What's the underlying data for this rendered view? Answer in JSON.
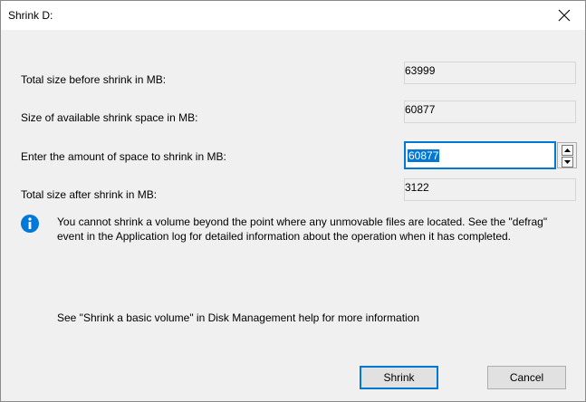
{
  "window": {
    "title": "Shrink D:"
  },
  "fields": {
    "total_before": {
      "label": "Total size before shrink in MB:",
      "value": "63999"
    },
    "available": {
      "label": "Size of available shrink space in MB:",
      "value": "60877"
    },
    "amount": {
      "label": "Enter the amount of space to shrink in MB:",
      "value": "60877"
    },
    "total_after": {
      "label": "Total size after shrink in MB:",
      "value": "3122"
    }
  },
  "info": {
    "icon": "info-icon",
    "text": "You cannot shrink a volume beyond the point where any unmovable files are located. See the \"defrag\" event in the Application log for detailed information about the operation when it has completed."
  },
  "help": {
    "text": "See \"Shrink a basic volume\" in Disk Management help for more information"
  },
  "buttons": {
    "shrink": "Shrink",
    "cancel": "Cancel"
  },
  "colors": {
    "accent": "#0078d7",
    "info_icon": "#0078d7"
  }
}
